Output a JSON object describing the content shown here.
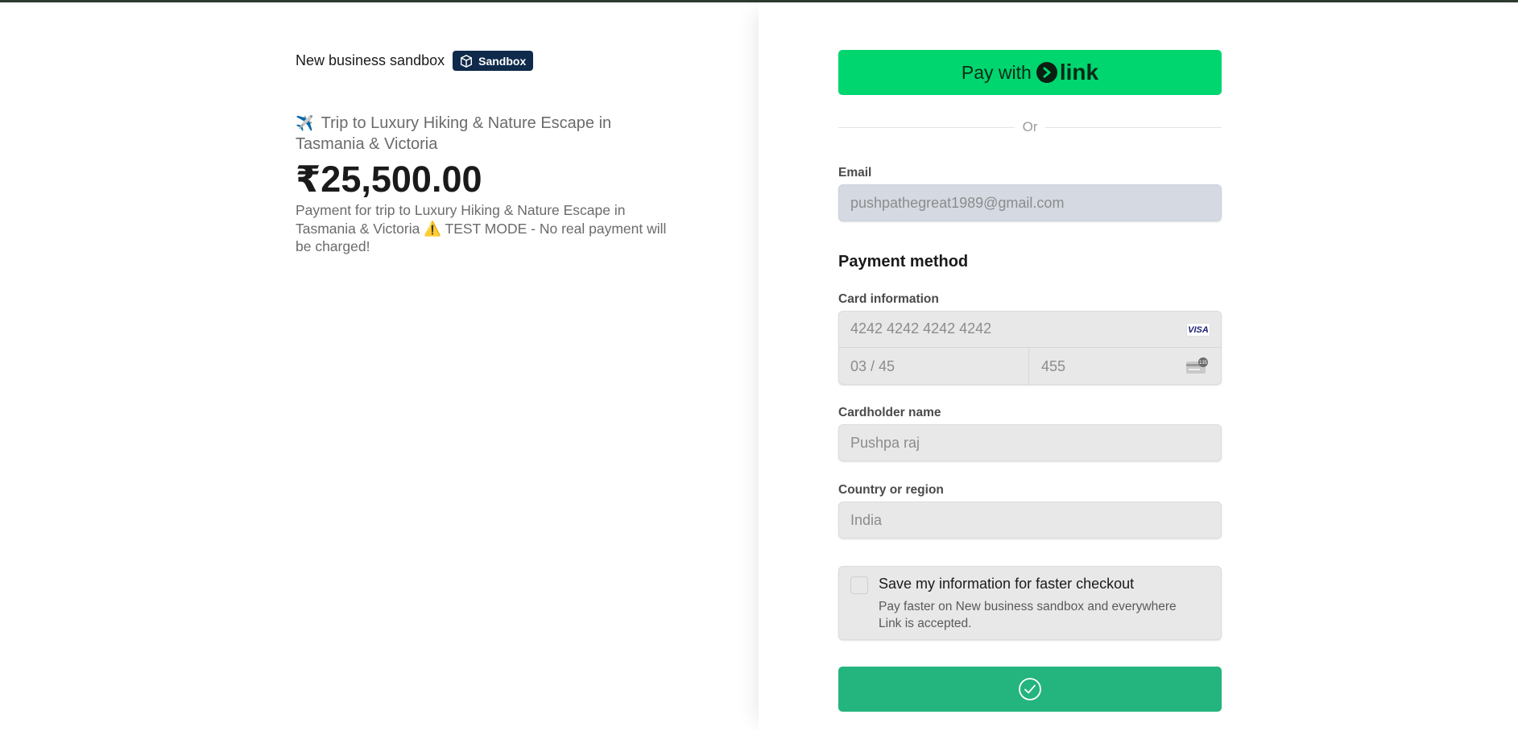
{
  "merchant": {
    "business_name": "New business sandbox",
    "badge_label": "Sandbox"
  },
  "product": {
    "title_emoji": "✈️",
    "title": "Trip to Luxury Hiking & Nature Escape in Tasmania & Victoria",
    "amount": "₹25,500.00",
    "description": "Payment for trip to Luxury Hiking & Nature Escape in Tasmania & Victoria ⚠️ TEST MODE - No real payment will be charged!"
  },
  "link_pay": {
    "prefix": "Pay with",
    "brand": "link"
  },
  "divider": {
    "or_text": "Or"
  },
  "email": {
    "label": "Email",
    "value": "pushpathegreat1989@gmail.com"
  },
  "payment_method": {
    "title": "Payment method",
    "card_label": "Card information",
    "card_number": "4242 4242 4242 4242",
    "card_brand": "VISA",
    "expiry": "03 / 45",
    "cvc": "455",
    "cvc_icon_text": "135"
  },
  "cardholder": {
    "label": "Cardholder name",
    "value": "Pushpa raj"
  },
  "country": {
    "label": "Country or region",
    "value": "India"
  },
  "save_info": {
    "title": "Save my information for faster checkout",
    "description": "Pay faster on New business sandbox and everywhere Link is accepted.",
    "checked": false
  },
  "pay_button": {
    "state": "success",
    "icon": "check-circle-icon"
  },
  "colors": {
    "link_green": "#00d66f",
    "pay_green": "#24b47e",
    "badge_navy": "#0f2a4a"
  }
}
